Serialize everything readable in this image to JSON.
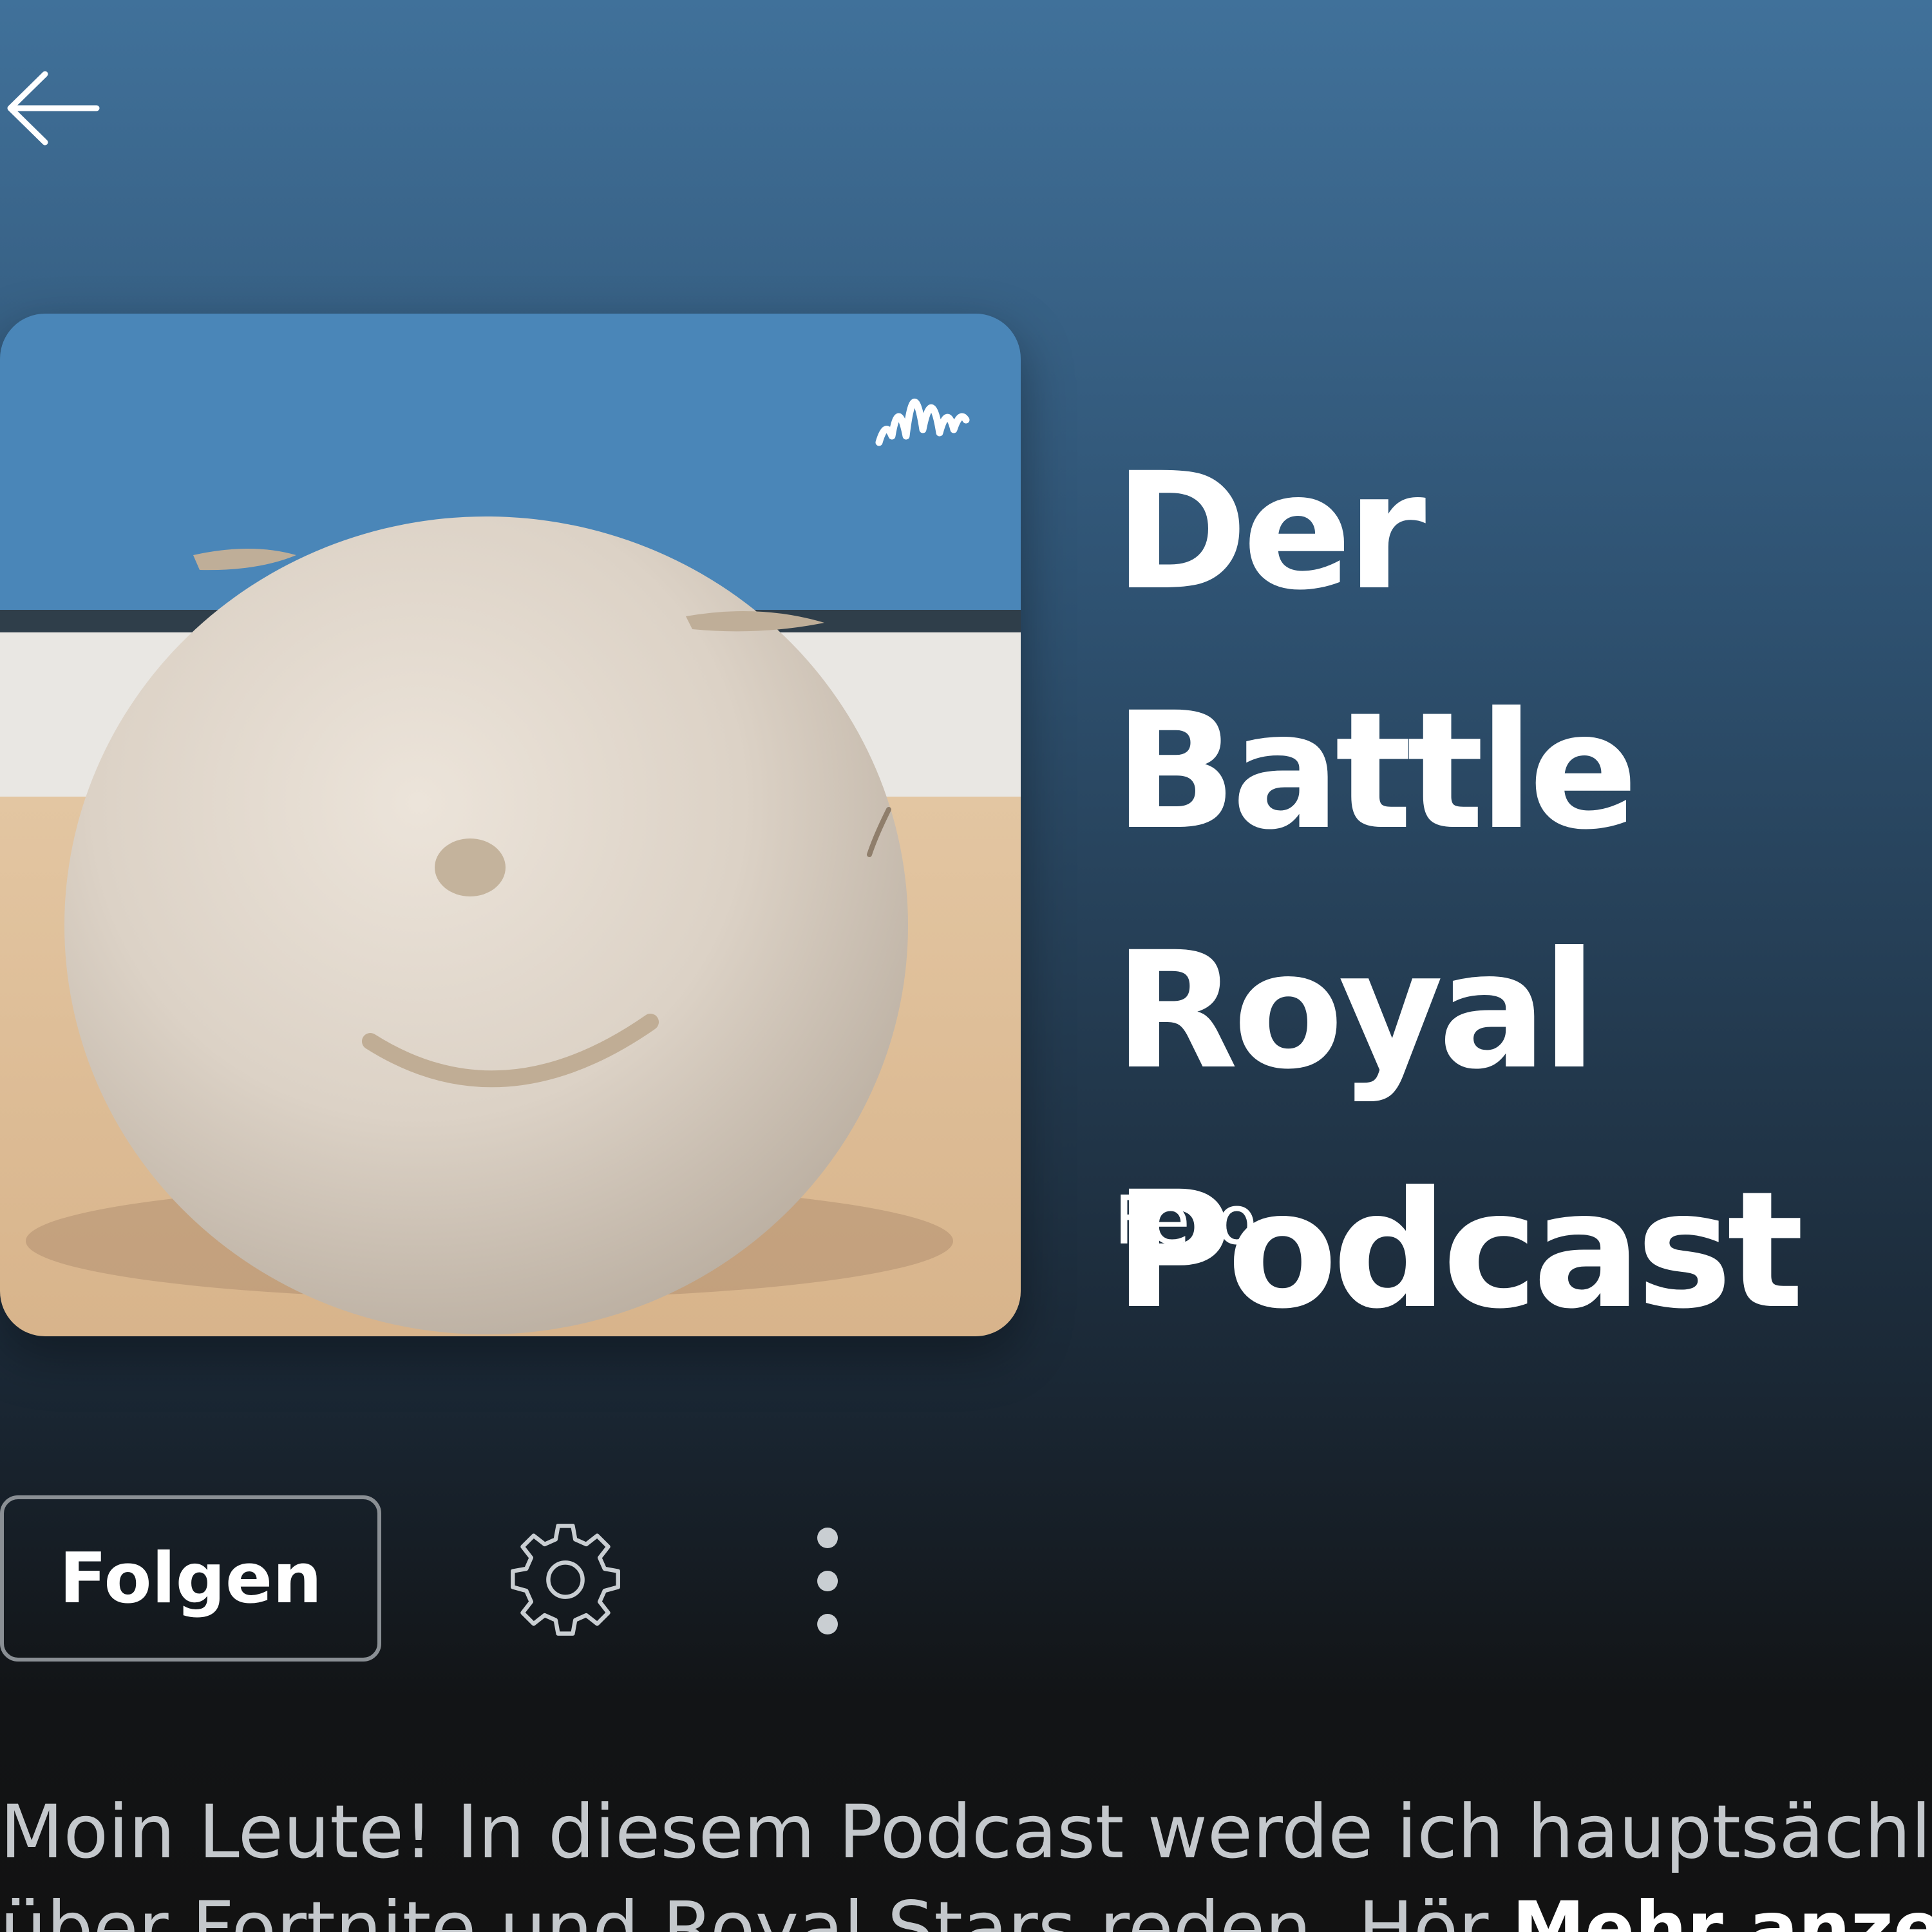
{
  "header": {
    "back_icon": "arrow-left-icon"
  },
  "cover": {
    "alt": "Podcast cover: smiling clay ball",
    "badge_icon": "anchor-waveform-icon"
  },
  "podcast": {
    "title": "Der Battle Royal Podcast",
    "author": "Fero"
  },
  "actions": {
    "follow_label": "Folgen",
    "settings_icon": "gear-icon",
    "more_icon": "more-vertical-icon"
  },
  "description": {
    "line1": "Moin Leute! In diesem Podcast werde ich hauptsächlich",
    "line2_start": "über Fortnite und Royal Stars reden. Hör",
    "more_label": "Mehr anzeigen"
  },
  "colors": {
    "bg_top": "#40719a",
    "bg_bottom": "#121212",
    "text_primary": "#ffffff",
    "text_secondary": "#c4c8cc",
    "button_border": "#8a8f94"
  }
}
